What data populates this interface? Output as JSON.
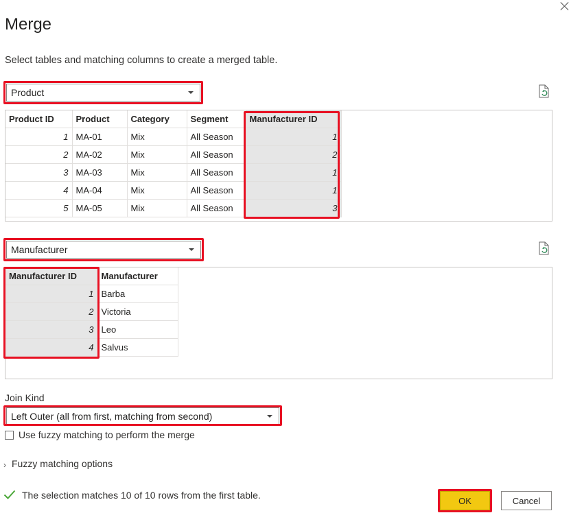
{
  "dialog": {
    "title": "Merge",
    "subtitle": "Select tables and matching columns to create a merged table."
  },
  "table1": {
    "selected": "Product",
    "columns": [
      "Product ID",
      "Product",
      "Category",
      "Segment",
      "Manufacturer ID"
    ],
    "rows": [
      [
        "1",
        "MA-01",
        "Mix",
        "All Season",
        "1"
      ],
      [
        "2",
        "MA-02",
        "Mix",
        "All Season",
        "2"
      ],
      [
        "3",
        "MA-03",
        "Mix",
        "All Season",
        "1"
      ],
      [
        "4",
        "MA-04",
        "Mix",
        "All Season",
        "1"
      ],
      [
        "5",
        "MA-05",
        "Mix",
        "All Season",
        "3"
      ]
    ]
  },
  "table2": {
    "selected": "Manufacturer",
    "columns": [
      "Manufacturer ID",
      "Manufacturer"
    ],
    "rows": [
      [
        "1",
        "Barba"
      ],
      [
        "2",
        "Victoria"
      ],
      [
        "3",
        "Leo"
      ],
      [
        "4",
        "Salvus"
      ]
    ]
  },
  "join": {
    "label": "Join Kind",
    "selected": "Left Outer (all from first, matching from second)"
  },
  "fuzzy": {
    "checkbox_label": "Use fuzzy matching to perform the merge",
    "options_label": "Fuzzy matching options"
  },
  "status": {
    "text": "The selection matches 10 of 10 rows from the first table."
  },
  "buttons": {
    "ok": "OK",
    "cancel": "Cancel"
  },
  "colors": {
    "highlight": "#e81123",
    "ok_button": "#f2c811",
    "selected_column": "#e6e6e6",
    "check": "#4ca83a"
  },
  "icons": [
    "close-icon",
    "refresh-icon",
    "chevron-down-icon",
    "chevron-right-icon",
    "checkmark-icon"
  ]
}
